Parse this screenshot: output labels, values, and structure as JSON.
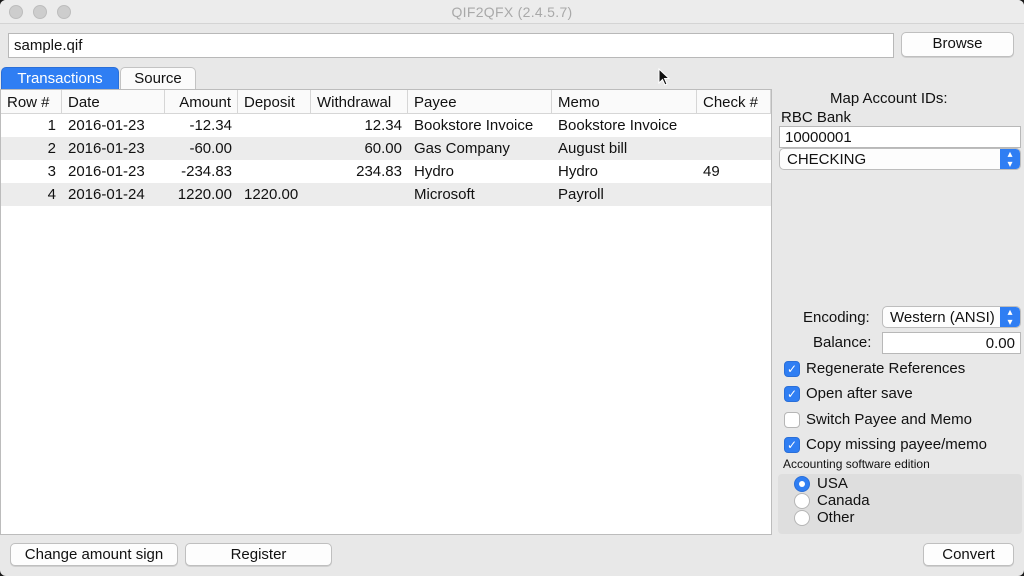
{
  "window": {
    "title": "QIF2QFX (2.4.5.7)"
  },
  "file": {
    "path": "sample.qif",
    "browse_label": "Browse"
  },
  "tabs": [
    {
      "label": "Transactions",
      "active": true
    },
    {
      "label": "Source",
      "active": false
    }
  ],
  "table": {
    "columns": [
      "Row #",
      "Date",
      "Amount",
      "Deposit",
      "Withdrawal",
      "Payee",
      "Memo",
      "Check #"
    ],
    "rows": [
      {
        "row": "1",
        "date": "2016-01-23",
        "amount": "-12.34",
        "deposit": "",
        "withdrawal": "12.34",
        "payee": "Bookstore Invoice",
        "memo": "Bookstore Invoice",
        "check": ""
      },
      {
        "row": "2",
        "date": "2016-01-23",
        "amount": "-60.00",
        "deposit": "",
        "withdrawal": "60.00",
        "payee": "Gas Company",
        "memo": "August bill",
        "check": ""
      },
      {
        "row": "3",
        "date": "2016-01-23",
        "amount": "-234.83",
        "deposit": "",
        "withdrawal": "234.83",
        "payee": "Hydro",
        "memo": "Hydro",
        "check": "49"
      },
      {
        "row": "4",
        "date": "2016-01-24",
        "amount": "1220.00",
        "deposit": "1220.00",
        "withdrawal": "",
        "payee": "Microsoft",
        "memo": "Payroll",
        "check": ""
      }
    ]
  },
  "sidebar": {
    "map_title": "Map Account IDs:",
    "bank_name": "RBC Bank",
    "account_id": "10000001",
    "account_type": "CHECKING",
    "encoding_label": "Encoding:",
    "encoding_value": "Western (ANSI)",
    "balance_label": "Balance:",
    "balance_value": "0.00",
    "options": [
      {
        "label": "Regenerate References",
        "checked": true
      },
      {
        "label": "Open after save",
        "checked": true
      },
      {
        "label": "Switch Payee and Memo",
        "checked": false
      },
      {
        "label": "Copy missing payee/memo",
        "checked": true
      }
    ],
    "edition_label": "Accounting software edition",
    "editions": [
      {
        "label": "USA",
        "selected": true
      },
      {
        "label": "Canada",
        "selected": false
      },
      {
        "label": "Other",
        "selected": false
      }
    ]
  },
  "bottom": {
    "change_sign_label": "Change amount sign",
    "register_label": "Register",
    "convert_label": "Convert"
  },
  "colors": {
    "accent": "#2f7ef3",
    "window_bg": "#e8e8e8",
    "alt_row": "#ececec"
  },
  "icons": {
    "checkmark": "check-icon",
    "dropdown": "chevron-updown-icon",
    "cursor": "mouse-pointer-icon"
  }
}
